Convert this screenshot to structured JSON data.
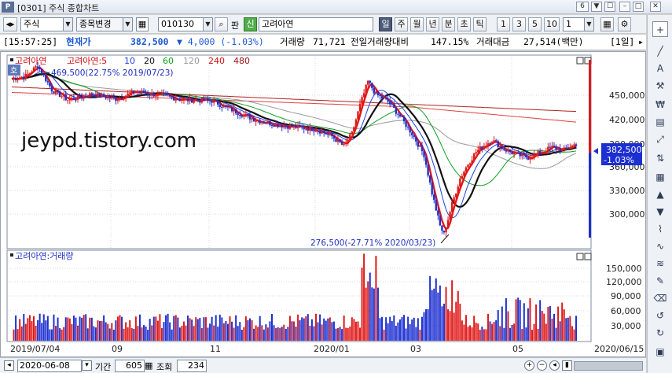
{
  "window": {
    "logo": "P",
    "title": "[0301] 주식 종합차트",
    "badge": "6",
    "controls": [
      "▼",
      "☐",
      "–",
      "□",
      "✕"
    ]
  },
  "toolbar": {
    "market": "주식",
    "menu_label": "종목변경",
    "code": "010130",
    "pan_label": "판",
    "credit_badge": "신",
    "stock_name": "고려아연",
    "periods": [
      "일",
      "주",
      "월",
      "년",
      "분",
      "초",
      "틱"
    ],
    "active_period": "일",
    "intervals": [
      "1",
      "3",
      "5",
      "10"
    ],
    "interval_value": "1"
  },
  "quote": {
    "time": "[15:57:25]",
    "price_label": "현재가",
    "price": "382,500",
    "change": "▼ 4,000 (-1.03%)",
    "volume_label": "거래량",
    "volume": "71,721",
    "prev_ratio_label": "전일거래량대비",
    "prev_ratio": "147.15%",
    "amount_label": "거래대금",
    "amount": "27,514(백만)",
    "period_tag": "[1일]"
  },
  "price_panel": {
    "legend": [
      "고려아연",
      "고려아연:5",
      "10",
      "20",
      "60",
      "120",
      "240",
      "480"
    ],
    "badge": "호",
    "max_annotation": "469,500(22.75% 2019/07/23)",
    "min_annotation": "276,500(-27.71% 2020/03/23)",
    "watermark": "jeypd.tistory.com",
    "y_ticks": [
      "450,000",
      "420,000",
      "390,000",
      "360,000",
      "330,000",
      "300,000"
    ],
    "current_price": "382,500",
    "current_change": "-1.03%"
  },
  "volume_panel": {
    "legend": "고려아연:거래량",
    "y_ticks": [
      "150,000",
      "120,000",
      "90,000",
      "60,000",
      "30,000"
    ]
  },
  "x_axis": {
    "labels": [
      "2019/07/04",
      "09",
      "11",
      "2020/01",
      "03",
      "05",
      "2020/06/15"
    ]
  },
  "chart_data": {
    "type": "line",
    "title": "",
    "series": [
      {
        "name": "고려아연",
        "x": [
          "2019/07/04",
          "2019/07/23",
          "2019/09",
          "2019/11",
          "2020/01",
          "2020/02",
          "2020/03/23",
          "2020/04",
          "2020/05",
          "2020/06/15"
        ],
        "values": [
          455000,
          469500,
          437000,
          430000,
          402000,
          445000,
          276500,
          380000,
          370000,
          382500
        ]
      },
      {
        "name": "고려아연:5",
        "x": [
          "2019/07/04",
          "2019/09",
          "2019/11",
          "2020/01",
          "2020/03/23",
          "2020/05",
          "2020/06/15"
        ],
        "values": [
          455000,
          438000,
          431000,
          404000,
          300000,
          372000,
          384000
        ]
      },
      {
        "name": "20",
        "x": [
          "2019/07/04",
          "2019/09",
          "2019/11",
          "2020/01",
          "2020/02",
          "2020/04",
          "2020/05",
          "2020/06/15"
        ],
        "values": [
          448000,
          440000,
          434000,
          410000,
          427000,
          356000,
          385000,
          378000
        ]
      }
    ],
    "ylim": [
      270000,
      480000
    ],
    "volume": {
      "name": "거래량",
      "ylim": [
        0,
        165000
      ],
      "max_value": 160000
    }
  }
}
